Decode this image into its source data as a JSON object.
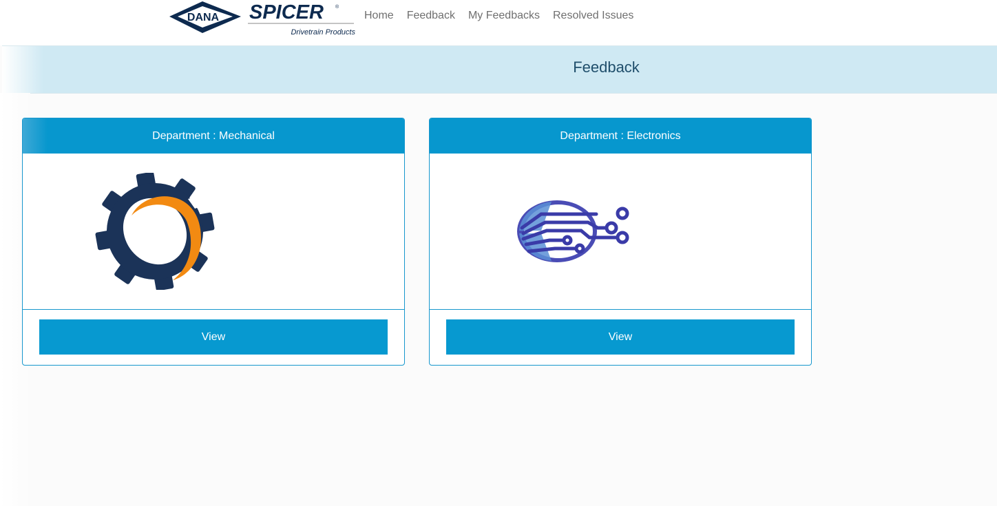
{
  "brand": {
    "logo_left_text": "DANA",
    "logo_right_text": "SPICER",
    "logo_subtext": "Drivetrain Products"
  },
  "nav": {
    "items": [
      {
        "label": "Home"
      },
      {
        "label": "Feedback"
      },
      {
        "label": "My Feedbacks"
      },
      {
        "label": "Resolved Issues"
      }
    ]
  },
  "banner": {
    "title": "Feedback"
  },
  "cards": [
    {
      "header": "Department : Mechanical",
      "icon": "gear-icon",
      "button_label": "View"
    },
    {
      "header": "Department : Electronics",
      "icon": "circuit-icon",
      "button_label": "View"
    }
  ],
  "colors": {
    "accent": "#0797ce",
    "banner_bg": "#cfe9f3",
    "gear_navy": "#1b3358",
    "gear_orange": "#f28a12",
    "circuit_blue": "#3a3ba8"
  }
}
